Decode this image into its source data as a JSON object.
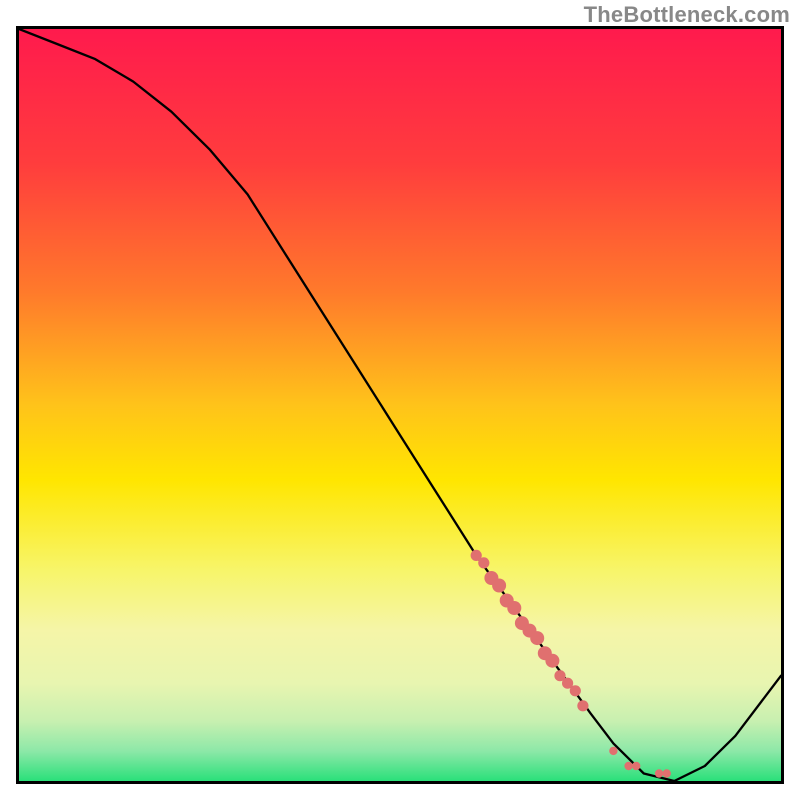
{
  "meta": {
    "watermark": "TheBottleneck.com"
  },
  "chart_data": {
    "type": "line",
    "title": "",
    "xlabel": "",
    "ylabel": "",
    "xlim": [
      0,
      100
    ],
    "ylim": [
      0,
      100
    ],
    "gradient_stops": [
      {
        "offset": 0,
        "color": "#ff1a4d"
      },
      {
        "offset": 0.18,
        "color": "#ff3d3d"
      },
      {
        "offset": 0.35,
        "color": "#ff7a2b"
      },
      {
        "offset": 0.5,
        "color": "#ffc31a"
      },
      {
        "offset": 0.6,
        "color": "#ffe600"
      },
      {
        "offset": 0.72,
        "color": "#f7f56a"
      },
      {
        "offset": 0.8,
        "color": "#f5f5a8"
      },
      {
        "offset": 0.87,
        "color": "#e8f5b0"
      },
      {
        "offset": 0.92,
        "color": "#c8f0b0"
      },
      {
        "offset": 0.96,
        "color": "#8de8a8"
      },
      {
        "offset": 1.0,
        "color": "#2ae07a"
      }
    ],
    "series": [
      {
        "name": "bottleneck-curve",
        "x": [
          0,
          5,
          10,
          15,
          20,
          25,
          30,
          35,
          40,
          45,
          50,
          55,
          60,
          65,
          70,
          75,
          78,
          82,
          86,
          90,
          94,
          100
        ],
        "y": [
          100,
          98,
          96,
          93,
          89,
          84,
          78,
          70,
          62,
          54,
          46,
          38,
          30,
          23,
          16,
          9,
          5,
          1,
          0,
          2,
          6,
          14
        ]
      }
    ],
    "scatter": [
      {
        "name": "highlight-cluster",
        "points": [
          {
            "x": 60,
            "y": 30,
            "r": 4
          },
          {
            "x": 61,
            "y": 29,
            "r": 4
          },
          {
            "x": 62,
            "y": 27,
            "r": 5
          },
          {
            "x": 63,
            "y": 26,
            "r": 5
          },
          {
            "x": 64,
            "y": 24,
            "r": 5
          },
          {
            "x": 65,
            "y": 23,
            "r": 5
          },
          {
            "x": 66,
            "y": 21,
            "r": 5
          },
          {
            "x": 67,
            "y": 20,
            "r": 5
          },
          {
            "x": 68,
            "y": 19,
            "r": 5
          },
          {
            "x": 69,
            "y": 17,
            "r": 5
          },
          {
            "x": 70,
            "y": 16,
            "r": 5
          },
          {
            "x": 71,
            "y": 14,
            "r": 4
          },
          {
            "x": 72,
            "y": 13,
            "r": 4
          },
          {
            "x": 73,
            "y": 12,
            "r": 4
          },
          {
            "x": 74,
            "y": 10,
            "r": 4
          },
          {
            "x": 78,
            "y": 4,
            "r": 3
          },
          {
            "x": 80,
            "y": 2,
            "r": 3
          },
          {
            "x": 81,
            "y": 2,
            "r": 3
          },
          {
            "x": 84,
            "y": 1,
            "r": 3
          },
          {
            "x": 85,
            "y": 1,
            "r": 3
          }
        ]
      }
    ]
  }
}
